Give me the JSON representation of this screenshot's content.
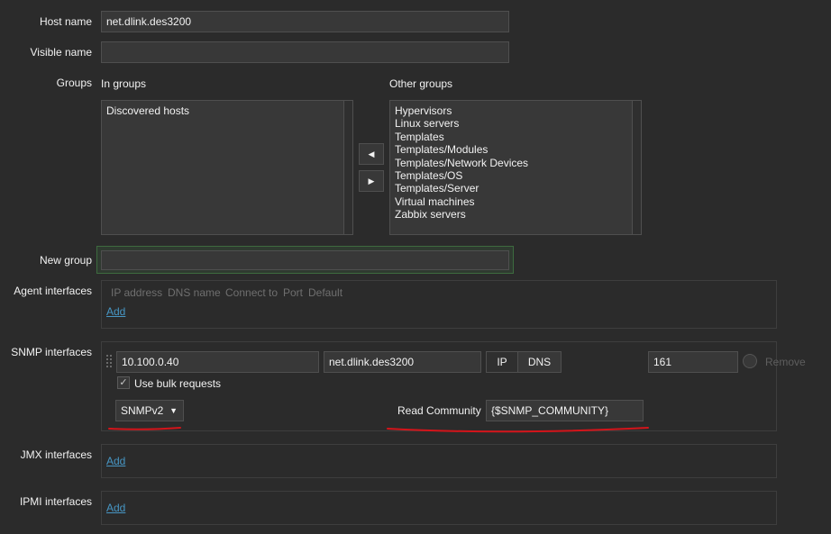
{
  "host": {
    "host_name_label": "Host name",
    "host_name_value": "net.dlink.des3200",
    "visible_name_label": "Visible name",
    "visible_name_value": ""
  },
  "groups": {
    "label": "Groups",
    "in_groups_label": "In groups",
    "other_groups_label": "Other groups",
    "in_groups": [
      "Discovered hosts"
    ],
    "other_groups": [
      "Hypervisors",
      "Linux servers",
      "Templates",
      "Templates/Modules",
      "Templates/Network Devices",
      "Templates/OS",
      "Templates/Server",
      "Virtual machines",
      "Zabbix servers"
    ],
    "move_left_icon": "triangle-left-icon",
    "move_right_icon": "triangle-right-icon"
  },
  "new_group": {
    "label": "New group",
    "value": ""
  },
  "agent_interfaces": {
    "label": "Agent interfaces",
    "columns": [
      "IP address",
      "DNS name",
      "Connect to",
      "Port",
      "Default"
    ],
    "add_label": "Add"
  },
  "snmp_interfaces": {
    "label": "SNMP interfaces",
    "ip": "10.100.0.40",
    "dns": "net.dlink.des3200",
    "connect_ip": "IP",
    "connect_dns": "DNS",
    "port": "161",
    "remove_label": "Remove",
    "bulk_label": "Use bulk requests",
    "bulk_checked": true,
    "version": "SNMPv2",
    "community_label": "Read Community",
    "community_value": "{$SNMP_COMMUNITY}"
  },
  "jmx_interfaces": {
    "label": "JMX interfaces",
    "add_label": "Add"
  },
  "ipmi_interfaces": {
    "label": "IPMI interfaces",
    "add_label": "Add"
  },
  "colors": {
    "background": "#2b2b2b",
    "link": "#4796c4",
    "annotation": "#d4141a",
    "focus_border": "#3d6b3f"
  }
}
